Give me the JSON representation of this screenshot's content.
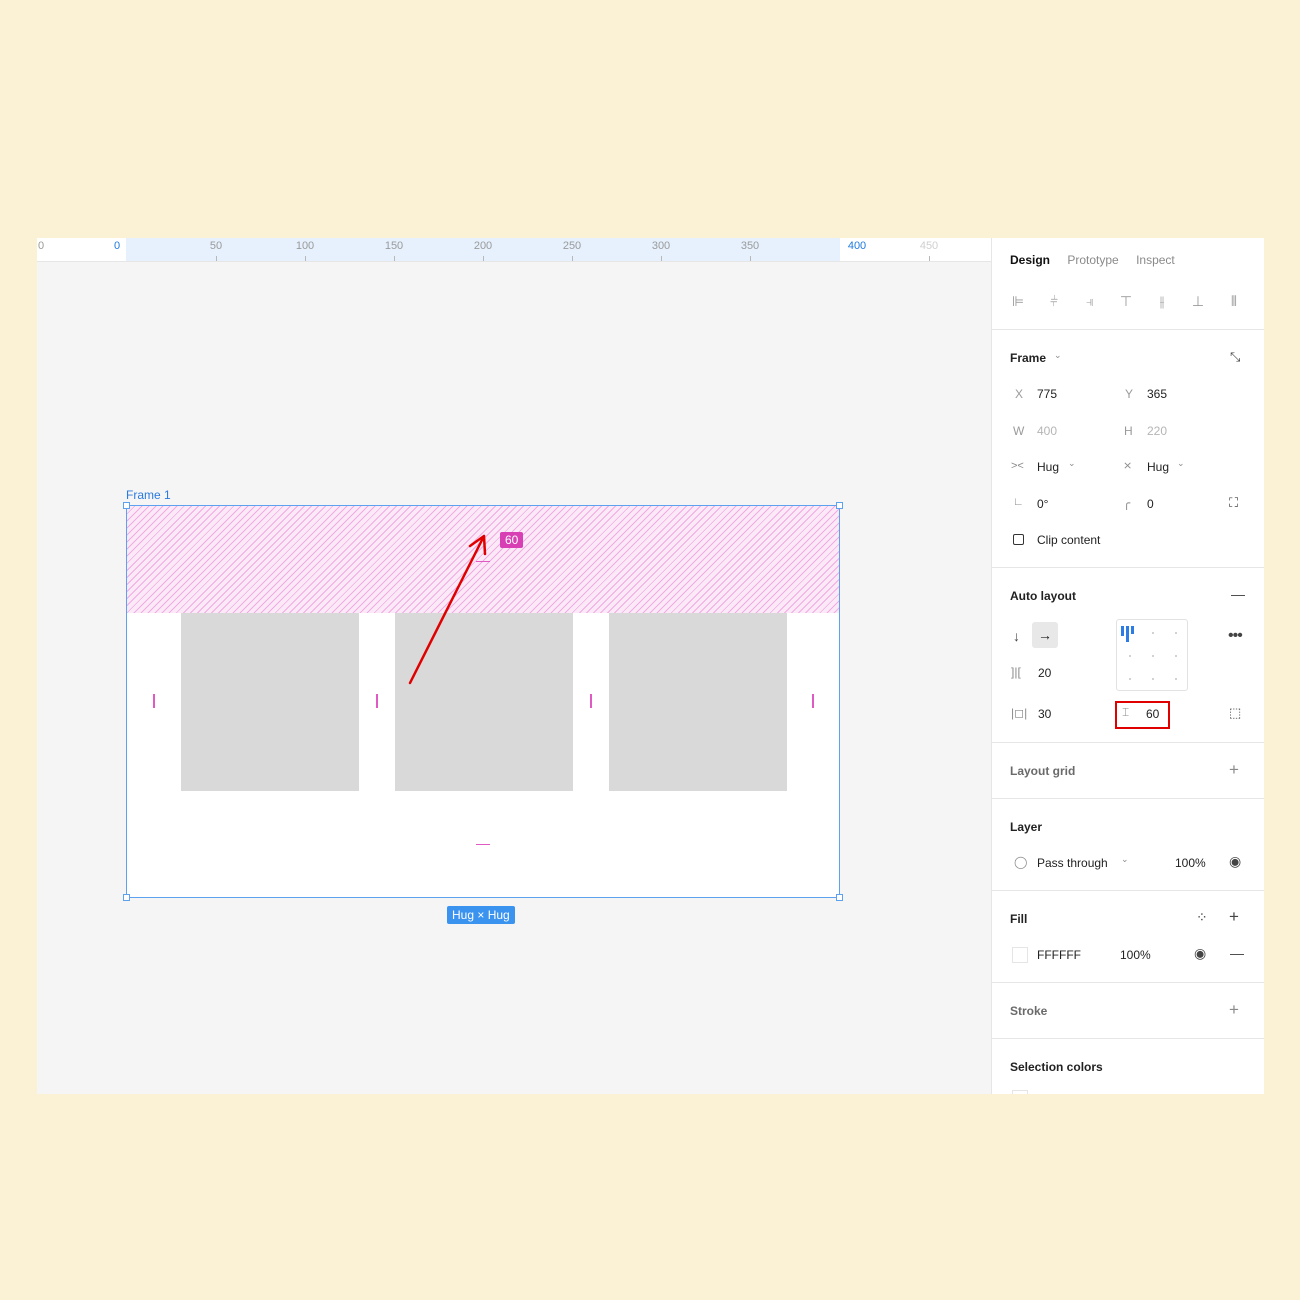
{
  "ruler": {
    "ticks": [
      "50",
      "100",
      "150",
      "200",
      "250",
      "300",
      "350"
    ],
    "start": "0",
    "end": "400",
    "edge_left": "0",
    "edge_right": "450"
  },
  "canvas": {
    "frame_name": "Frame 1",
    "padding_badge": "60",
    "size_badge": "Hug × Hug"
  },
  "panel": {
    "tabs": [
      "Design",
      "Prototype",
      "Inspect"
    ],
    "frame": {
      "title": "Frame",
      "x_label": "X",
      "x": "775",
      "y_label": "Y",
      "y": "365",
      "w_label": "W",
      "w": "400",
      "h_label": "H",
      "h": "220",
      "width_mode": "Hug",
      "height_mode": "Hug",
      "rotation": "0°",
      "radius": "0",
      "clip_content": "Clip content"
    },
    "auto_layout": {
      "title": "Auto layout",
      "direction": "horizontal",
      "spacing": "20",
      "horizontal_padding": "30",
      "vertical_padding": "60"
    },
    "layout_grid": {
      "title": "Layout grid"
    },
    "layer": {
      "title": "Layer",
      "blend": "Pass through",
      "opacity": "100%"
    },
    "fill": {
      "title": "Fill",
      "color": "FFFFFF",
      "opacity": "100%"
    },
    "stroke": {
      "title": "Stroke"
    },
    "selection_colors": {
      "title": "Selection colors"
    }
  },
  "colors": {
    "background": "#fbf2d6",
    "selection": "#5ea2ef",
    "padding_highlight": "#d83fb4",
    "annotation": "#e00000"
  }
}
